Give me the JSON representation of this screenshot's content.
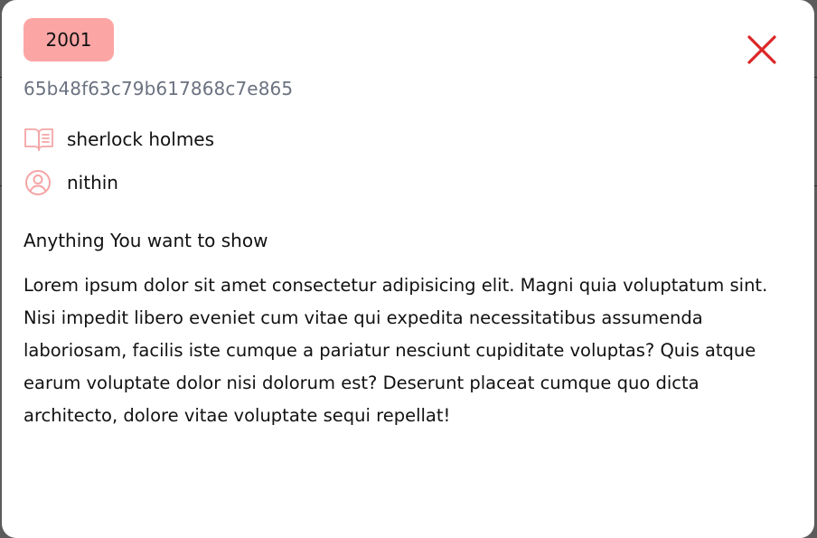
{
  "modal": {
    "badge": "2001",
    "record_id": "65b48f63c79b617868c7e865",
    "book": {
      "icon": "book-open-icon",
      "title": "sherlock holmes"
    },
    "user": {
      "icon": "user-circle-icon",
      "name": "nithin"
    },
    "section_title": "Anything You want to show",
    "body": "Lorem ipsum dolor sit amet consectetur adipisicing elit. Magni quia voluptatum sint. Nisi impedit libero eveniet cum vitae qui expedita necessitatibus assumenda laboriosam, facilis iste cumque a pariatur nesciunt cupiditate voluptas? Quis atque earum voluptate dolor nisi dolorum est? Deserunt placeat cumque quo dicta architecto, dolore vitae voluptate sequi repellat!",
    "close_icon": "close-icon"
  },
  "colors": {
    "badge_bg": "#fca5a5",
    "icon_accent": "#f4a5a5",
    "close": "#dc2626",
    "muted_text": "#6b7280"
  }
}
